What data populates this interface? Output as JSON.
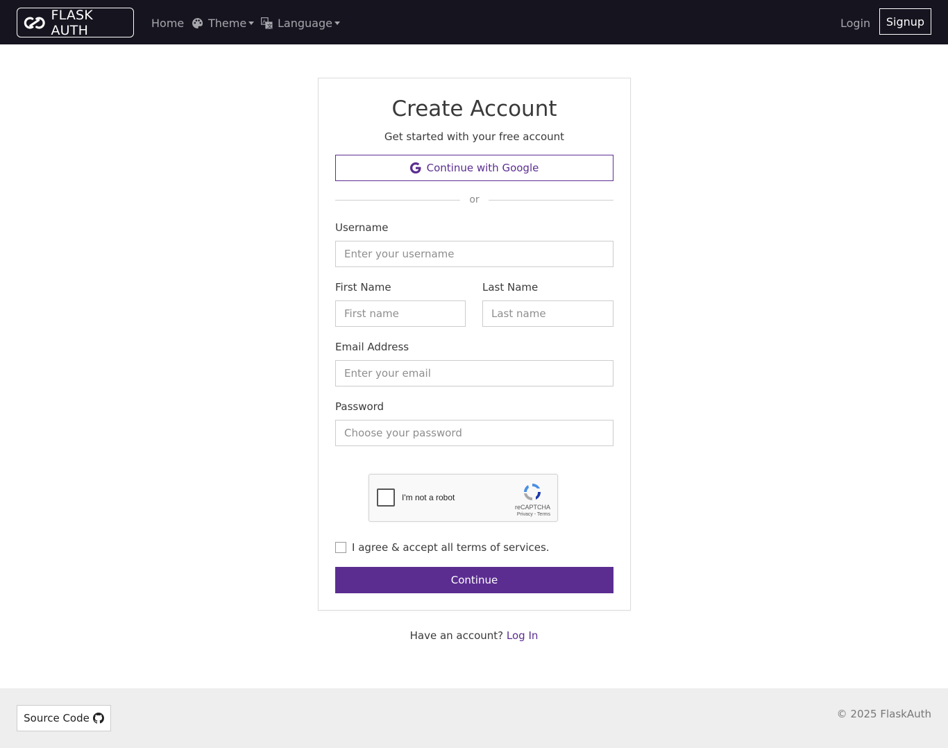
{
  "navbar": {
    "brand": "FLASK AUTH",
    "home": "Home",
    "theme": "Theme",
    "language": "Language",
    "login": "Login",
    "signup": "Signup"
  },
  "card": {
    "title": "Create Account",
    "subtitle": "Get started with your free account",
    "google_button": "Continue with Google",
    "divider": "or",
    "username_label": "Username",
    "username_placeholder": "Enter your username",
    "first_name_label": "First Name",
    "first_name_placeholder": "First name",
    "last_name_label": "Last Name",
    "last_name_placeholder": "Last name",
    "email_label": "Email Address",
    "email_placeholder": "Enter your email",
    "password_label": "Password",
    "password_placeholder": "Choose your password",
    "recaptcha": {
      "label": "I'm not a robot",
      "brand": "reCAPTCHA",
      "links": "Privacy - Terms"
    },
    "terms": "I agree & accept all terms of services.",
    "continue_button": "Continue"
  },
  "login_prompt": {
    "text": "Have an account?",
    "link": "Log In"
  },
  "footer": {
    "source_button": "Source Code",
    "copyright": "© 2025 FlaskAuth"
  },
  "colors": {
    "navbar_bg": "#16141f",
    "accent": "#5b2d91",
    "footer_bg": "#eeeeee"
  },
  "icons": {
    "brand": "link-logo-icon",
    "theme": "palette-icon",
    "language": "translate-icon",
    "google": "google-icon",
    "recaptcha": "recaptcha-icon",
    "source": "github-icon"
  }
}
